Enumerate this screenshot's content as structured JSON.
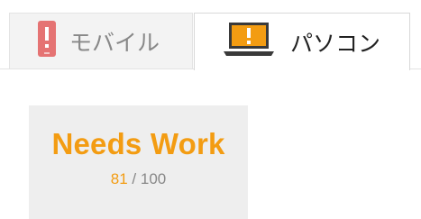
{
  "tabs": [
    {
      "label": "モバイル",
      "icon": "smartphone-warning-icon",
      "active": false
    },
    {
      "label": "パソコン",
      "icon": "laptop-warning-icon",
      "active": true
    }
  ],
  "score": {
    "title": "Needs Work",
    "value": "81",
    "separator": "/",
    "max": "100"
  },
  "colors": {
    "warning_orange": "#f39c12",
    "mobile_red": "#e57373",
    "laptop_dark": "#3a3a3a",
    "card_bg": "#eeeeee"
  }
}
